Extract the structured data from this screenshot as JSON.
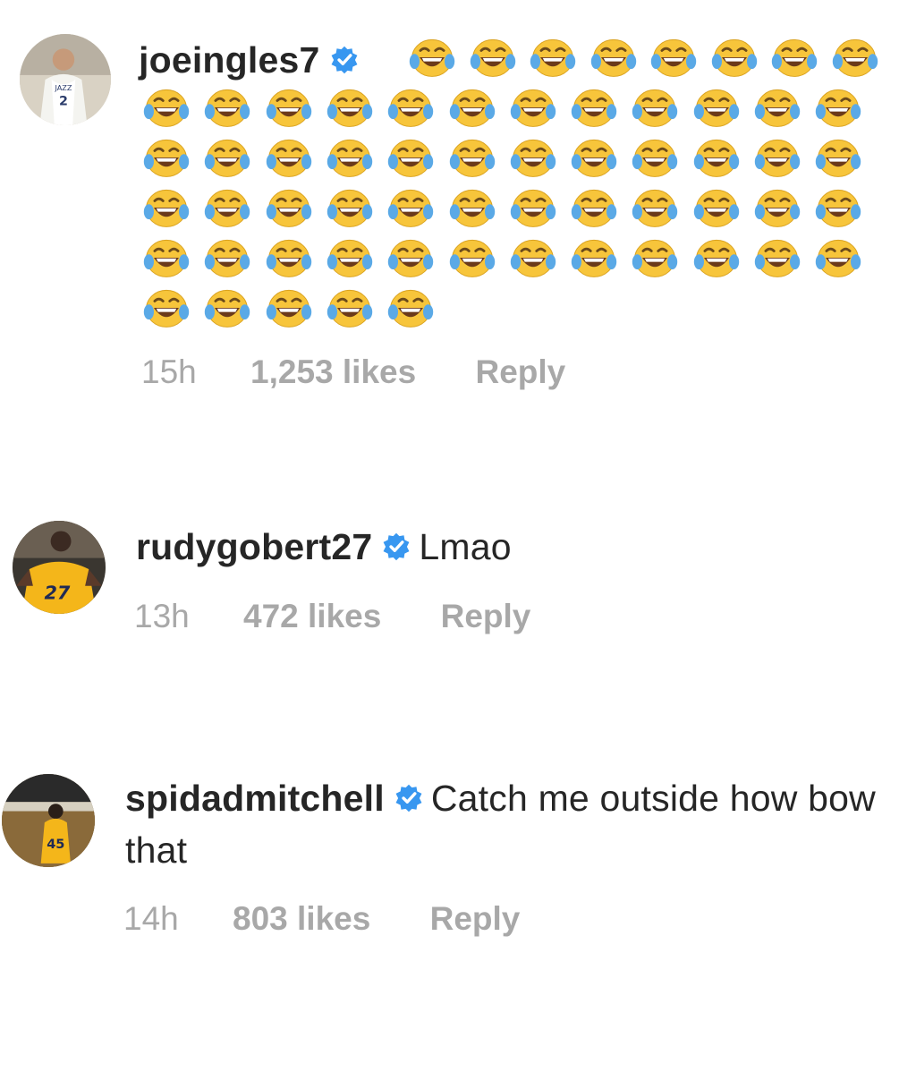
{
  "comments": [
    {
      "username": "joeingles7",
      "verified": true,
      "text": "",
      "emoji_name": "face-with-tears-of-joy",
      "emoji_count": 61,
      "time": "15h",
      "likes": "1,253 likes",
      "reply": "Reply",
      "avatar_jersey": "2"
    },
    {
      "username": "rudygobert27",
      "verified": true,
      "text": "Lmao",
      "time": "13h",
      "likes": "472 likes",
      "reply": "Reply",
      "avatar_jersey": "27"
    },
    {
      "username": "spidadmitchell",
      "verified": true,
      "text": "Catch me outside how bow that",
      "time": "14h",
      "likes": "803 likes",
      "reply": "Reply",
      "avatar_jersey": "45"
    }
  ],
  "colors": {
    "verified_badge": "#3897f0",
    "meta_text": "#a8a8a8",
    "emoji_face": "#f7c53b",
    "emoji_tear": "#5aa9e6"
  }
}
